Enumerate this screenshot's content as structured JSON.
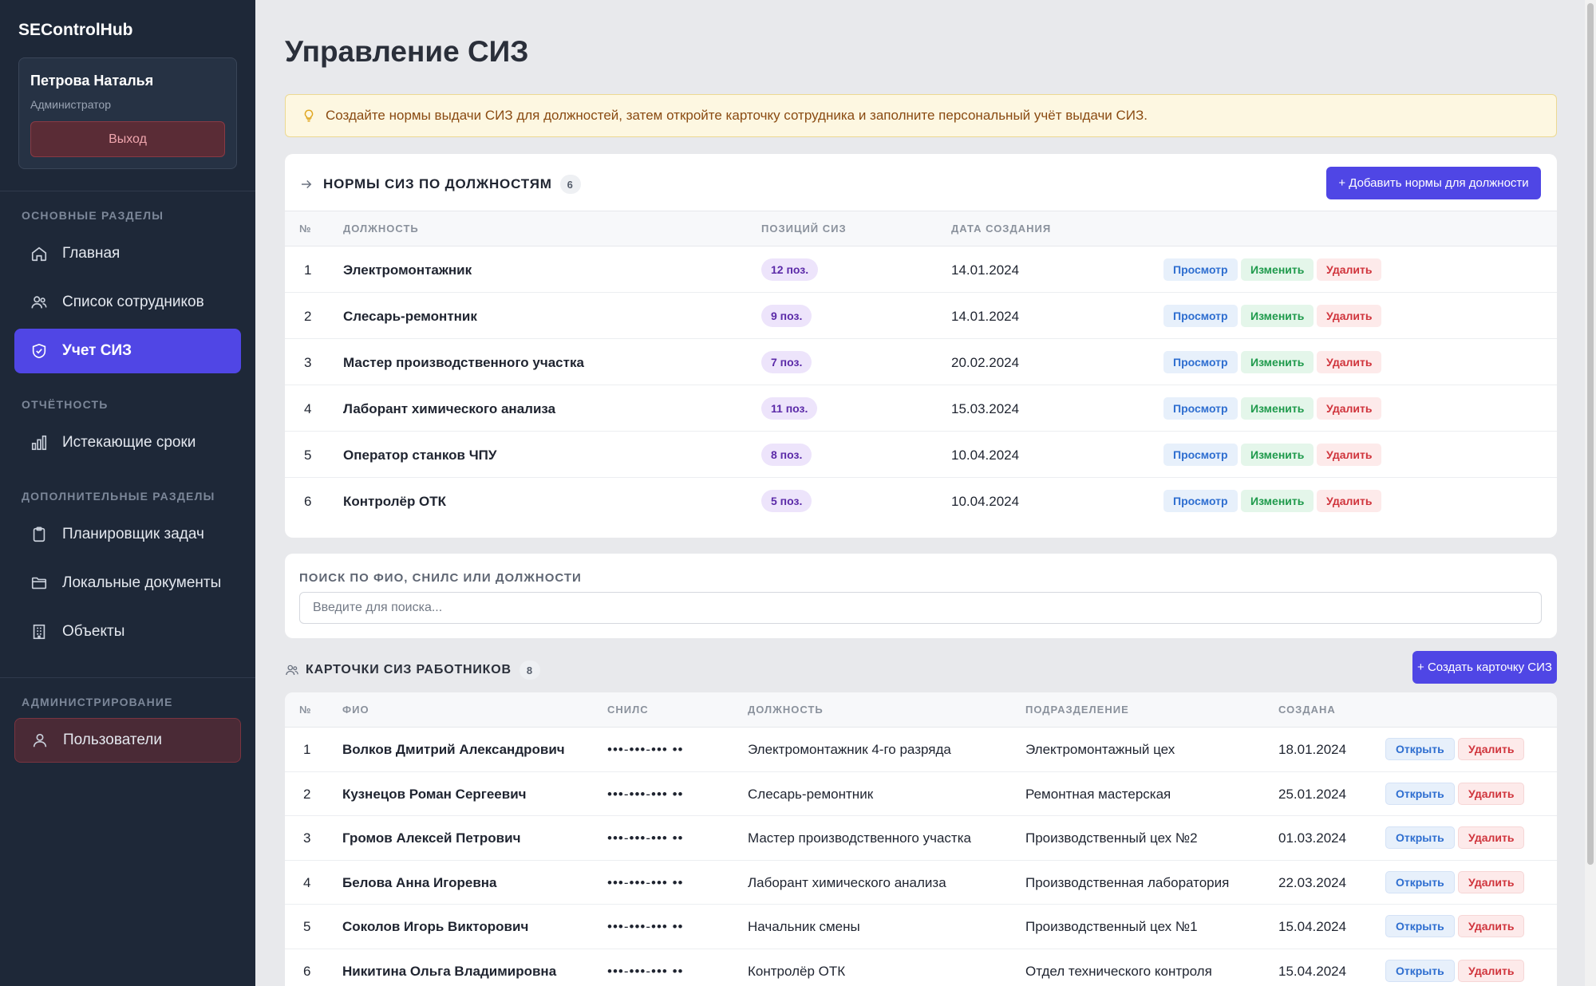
{
  "app": {
    "brand": "SEControlHub"
  },
  "user": {
    "name": "Петрова Наталья",
    "role": "Администратор",
    "logout": "Выход"
  },
  "nav": {
    "sections": {
      "main": "ОСНОВНЫЕ РАЗДЕЛЫ",
      "reports": "ОТЧЁТНОСТЬ",
      "extra": "ДОПОЛНИТЕЛЬНЫЕ РАЗДЕЛЫ",
      "admin": "АДМИНИСТРИРОВАНИЕ"
    },
    "items": {
      "home": {
        "label": "Главная",
        "icon": "home-icon"
      },
      "employees": {
        "label": "Список сотрудников",
        "icon": "users-icon"
      },
      "siz": {
        "label": "Учет СИЗ",
        "icon": "shield-icon"
      },
      "expiring": {
        "label": "Истекающие сроки",
        "icon": "bar-chart-icon"
      },
      "planner": {
        "label": "Планировщик задач",
        "icon": "clipboard-icon"
      },
      "docs": {
        "label": "Локальные документы",
        "icon": "folder-icon"
      },
      "objects": {
        "label": "Объекты",
        "icon": "building-icon"
      },
      "users": {
        "label": "Пользователи",
        "icon": "user-icon"
      }
    }
  },
  "page": {
    "title": "Управление СИЗ",
    "hint": "Создайте нормы выдачи СИЗ для должностей, затем откройте карточку сотрудника и заполните персональный учёт выдачи СИЗ."
  },
  "norms": {
    "title": "НОРМЫ СИЗ ПО ДОЛЖНОСТЯМ",
    "count": "6",
    "add_button": "+ Добавить нормы для должности",
    "headers": {
      "num": "№",
      "position": "ДОЛЖНОСТЬ",
      "items": "ПОЗИЦИЙ СИЗ",
      "created": "ДАТА СОЗДАНИЯ"
    },
    "actions": {
      "view": "Просмотр",
      "edit": "Изменить",
      "delete": "Удалить"
    },
    "rows": [
      {
        "num": "1",
        "position": "Электромонтажник",
        "items": "12 поз.",
        "created": "14.01.2024"
      },
      {
        "num": "2",
        "position": "Слесарь-ремонтник",
        "items": "9 поз.",
        "created": "14.01.2024"
      },
      {
        "num": "3",
        "position": "Мастер производственного участка",
        "items": "7 поз.",
        "created": "20.02.2024"
      },
      {
        "num": "4",
        "position": "Лаборант химического анализа",
        "items": "11 поз.",
        "created": "15.03.2024"
      },
      {
        "num": "5",
        "position": "Оператор станков ЧПУ",
        "items": "8 поз.",
        "created": "10.04.2024"
      },
      {
        "num": "6",
        "position": "Контролёр ОТК",
        "items": "5 поз.",
        "created": "10.04.2024"
      }
    ]
  },
  "search": {
    "label": "ПОИСК ПО ФИО, СНИЛС ИЛИ ДОЛЖНОСТИ",
    "placeholder": "Введите для поиска..."
  },
  "workers": {
    "title": "КАРТОЧКИ СИЗ РАБОТНИКОВ",
    "count": "8",
    "create_button": "+ Создать карточку СИЗ",
    "headers": {
      "num": "№",
      "name": "ФИО",
      "snils": "СНИЛС",
      "position": "ДОЛЖНОСТЬ",
      "department": "ПОДРАЗДЕЛЕНИЕ",
      "created": "СОЗДАНА"
    },
    "actions": {
      "open": "Открыть",
      "delete": "Удалить"
    },
    "rows": [
      {
        "num": "1",
        "name": "Волков Дмитрий Александрович",
        "snils": "•••-•••-••• ••",
        "position": "Электромонтажник 4-го разряда",
        "department": "Электромонтажный цех",
        "created": "18.01.2024"
      },
      {
        "num": "2",
        "name": "Кузнецов Роман Сергеевич",
        "snils": "•••-•••-••• ••",
        "position": "Слесарь-ремонтник",
        "department": "Ремонтная мастерская",
        "created": "25.01.2024"
      },
      {
        "num": "3",
        "name": "Громов Алексей Петрович",
        "snils": "•••-•••-••• ••",
        "position": "Мастер производственного участка",
        "department": "Производственный цех №2",
        "created": "01.03.2024"
      },
      {
        "num": "4",
        "name": "Белова Анна Игоревна",
        "snils": "•••-•••-••• ••",
        "position": "Лаборант химического анализа",
        "department": "Производственная лаборатория",
        "created": "22.03.2024"
      },
      {
        "num": "5",
        "name": "Соколов Игорь Викторович",
        "snils": "•••-•••-••• ••",
        "position": "Начальник смены",
        "department": "Производственный цех №1",
        "created": "15.04.2024"
      },
      {
        "num": "6",
        "name": "Никитина Ольга Владимировна",
        "snils": "•••-•••-••• ••",
        "position": "Контролёр ОТК",
        "department": "Отдел технического контроля",
        "created": "15.04.2024"
      }
    ]
  }
}
